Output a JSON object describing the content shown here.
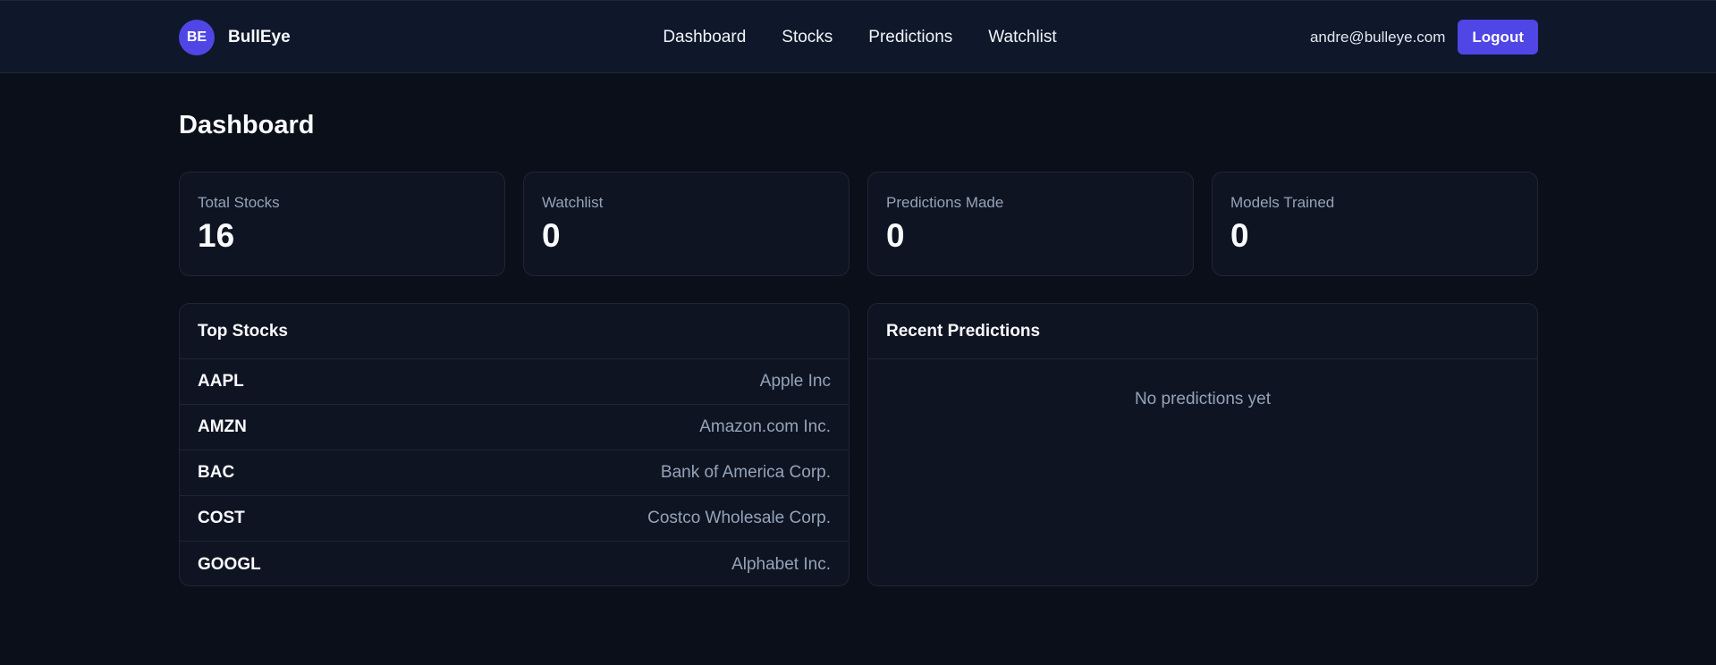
{
  "brand": {
    "logo_text": "BE",
    "name": "BullEye",
    "accent_color": "#4f46e5"
  },
  "nav": {
    "links": [
      "Dashboard",
      "Stocks",
      "Predictions",
      "Watchlist"
    ]
  },
  "user": {
    "email": "andre@bulleye.com",
    "logout_label": "Logout"
  },
  "page": {
    "title": "Dashboard"
  },
  "stats": [
    {
      "label": "Total Stocks",
      "value": "16"
    },
    {
      "label": "Watchlist",
      "value": "0"
    },
    {
      "label": "Predictions Made",
      "value": "0"
    },
    {
      "label": "Models Trained",
      "value": "0"
    }
  ],
  "top_stocks": {
    "title": "Top Stocks",
    "rows": [
      {
        "ticker": "AAPL",
        "name": "Apple Inc"
      },
      {
        "ticker": "AMZN",
        "name": "Amazon.com Inc."
      },
      {
        "ticker": "BAC",
        "name": "Bank of America Corp."
      },
      {
        "ticker": "COST",
        "name": "Costco Wholesale Corp."
      },
      {
        "ticker": "GOOGL",
        "name": "Alphabet Inc."
      }
    ]
  },
  "recent_predictions": {
    "title": "Recent Predictions",
    "empty_text": "No predictions yet"
  }
}
